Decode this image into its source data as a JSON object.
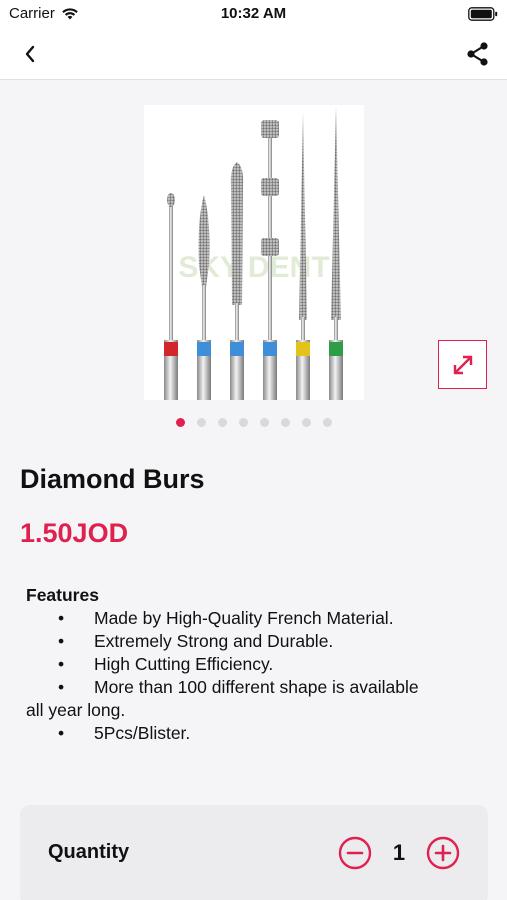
{
  "status_bar": {
    "carrier": "Carrier",
    "time": "10:32 AM"
  },
  "nav": {
    "back_icon": "chevron-left-icon",
    "share_icon": "share-icon"
  },
  "gallery": {
    "image_count": 8,
    "active_index": 0,
    "expand_icon": "expand-arrows-icon",
    "watermark": "SKY DENT"
  },
  "product": {
    "title": "Diamond Burs",
    "price": "1.50JOD"
  },
  "features": {
    "heading": "Features",
    "bullet": "•",
    "items": [
      "Made by High-Quality French Material.",
      "Extremely Strong and Durable.",
      "High Cutting Efficiency.",
      "More than 100 different shape is available"
    ],
    "continuation": "all year long.",
    "last_item": "5Pcs/Blister."
  },
  "quantity": {
    "label": "Quantity",
    "value": "1",
    "minus_icon": "minus-circle-icon",
    "plus_icon": "plus-circle-icon"
  },
  "colors": {
    "accent": "#e0204f",
    "background": "#f5f5f7",
    "card": "#ececef"
  }
}
